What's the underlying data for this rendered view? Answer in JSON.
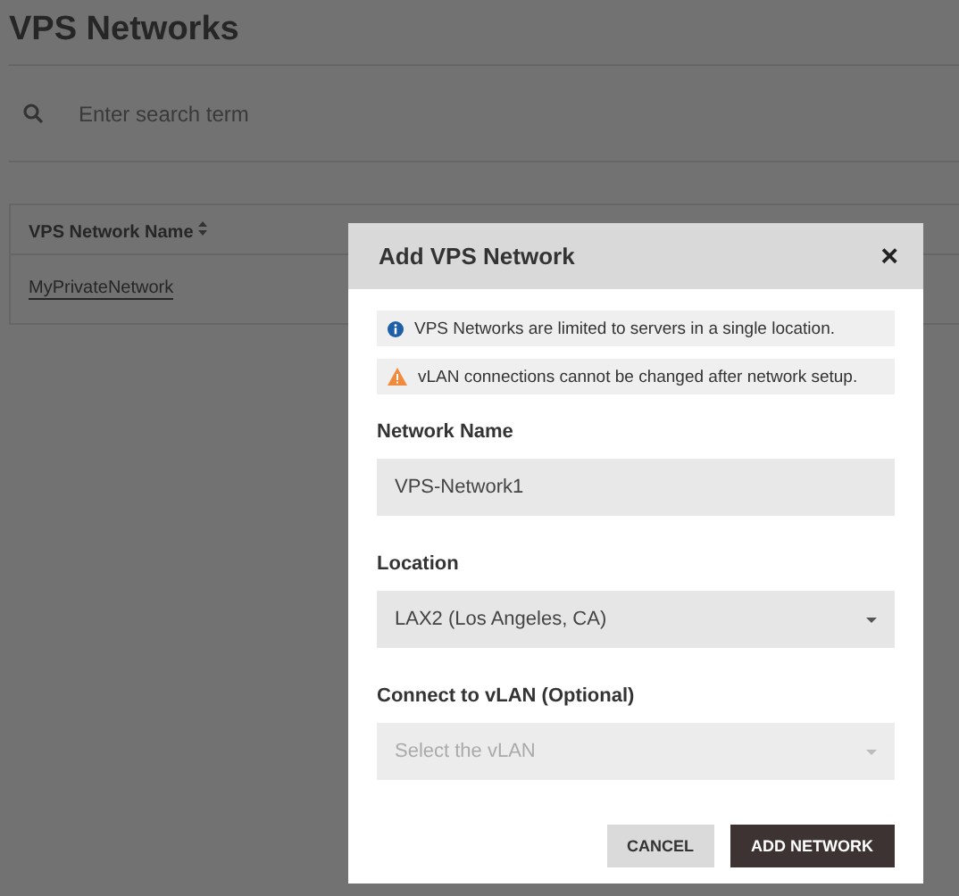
{
  "page": {
    "title": "VPS Networks"
  },
  "search": {
    "placeholder": "Enter search term"
  },
  "table": {
    "columns": [
      {
        "label": "VPS Network Name",
        "sortable": true
      }
    ],
    "rows": [
      {
        "name": "MyPrivateNetwork"
      }
    ]
  },
  "dialog": {
    "title": "Add VPS Network",
    "close": "×",
    "notices": [
      {
        "kind": "info",
        "text": "VPS Networks are limited to servers in a single location."
      },
      {
        "kind": "warning",
        "text": "vLAN connections cannot be changed after network setup."
      }
    ],
    "fields": [
      {
        "kind": "text",
        "label": "Network Name",
        "value": "VPS-Network1"
      },
      {
        "kind": "select",
        "label": "Location",
        "value": "LAX2 (Los Angeles, CA)",
        "disabled": false
      },
      {
        "kind": "select",
        "label": "Connect to vLAN (Optional)",
        "placeholder": "Select the vLAN",
        "disabled": true
      }
    ],
    "buttons": [
      {
        "kind": "secondary",
        "label": "CANCEL"
      },
      {
        "kind": "primary",
        "label": "ADD NETWORK"
      }
    ]
  }
}
